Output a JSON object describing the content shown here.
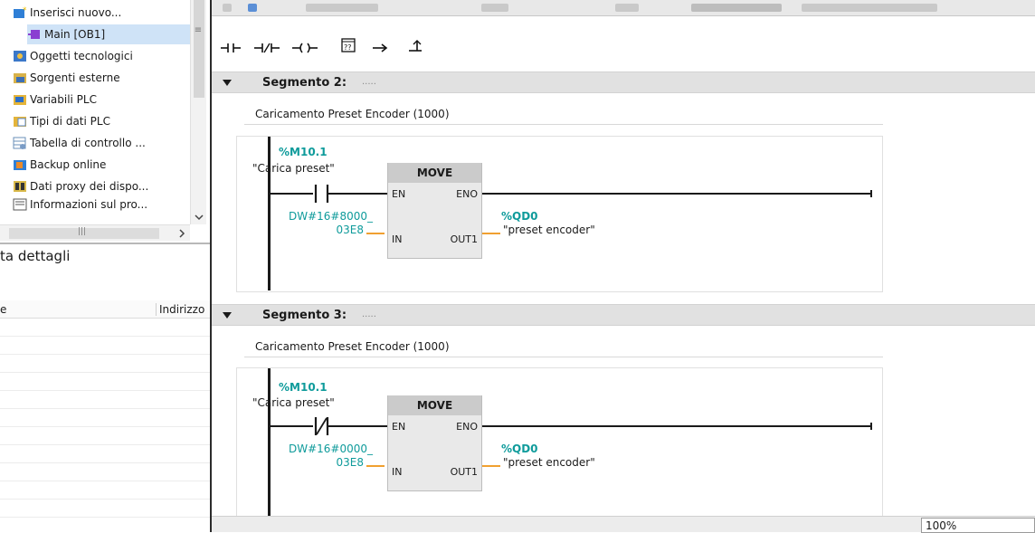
{
  "tree": {
    "items": [
      {
        "label": "Inserisci nuovo...",
        "icon": "add-block-icon",
        "indent": 1
      },
      {
        "label": "Main [OB1]",
        "icon": "ob-block-icon",
        "indent": 2,
        "selected": true
      },
      {
        "label": "Oggetti tecnologici",
        "icon": "technology-objects-icon",
        "indent": 0
      },
      {
        "label": "Sorgenti esterne",
        "icon": "external-sources-icon",
        "indent": 0
      },
      {
        "label": "Variabili PLC",
        "icon": "plc-tags-icon",
        "indent": 0
      },
      {
        "label": "Tipi di dati PLC",
        "icon": "plc-data-types-icon",
        "indent": 0
      },
      {
        "label": "Tabella di controllo ...",
        "icon": "watch-table-icon",
        "indent": 0
      },
      {
        "label": "Backup online",
        "icon": "online-backup-icon",
        "indent": 0
      },
      {
        "label": "Dati proxy dei dispo...",
        "icon": "device-proxy-icon",
        "indent": 0
      },
      {
        "label": "Informazioni sul pro...",
        "icon": "program-info-icon",
        "indent": 0
      }
    ]
  },
  "details": {
    "title": "ta dettagli",
    "col_name": "e",
    "col_address": "Indirizzo"
  },
  "toolbar": {
    "tools": [
      "no-contact-icon",
      "nc-contact-icon",
      "coil-icon",
      "empty-box-icon",
      "open-branch-icon",
      "close-branch-icon"
    ]
  },
  "segments": [
    {
      "title": "Segmento 2:",
      "dots": ".....",
      "comment": "Caricamento Preset Encoder (1000)",
      "contact_type": "normally-open",
      "contact_address": "%M10.1",
      "contact_name": "\"Carica preset\"",
      "box_title": "MOVE",
      "pin_en": "EN",
      "pin_eno": "ENO",
      "pin_in": "IN",
      "pin_out": "OUT1",
      "in_const_line1": "DW#16#8000_",
      "in_const_line2": "03E8",
      "out_address": "%QD0",
      "out_name": "\"preset encoder\""
    },
    {
      "title": "Segmento 3:",
      "dots": ".....",
      "comment": "Caricamento Preset Encoder (1000)",
      "contact_type": "normally-closed",
      "contact_address": "%M10.1",
      "contact_name": "\"Carica preset\"",
      "box_title": "MOVE",
      "pin_en": "EN",
      "pin_eno": "ENO",
      "pin_in": "IN",
      "pin_out": "OUT1",
      "in_const_line1": "DW#16#0000_",
      "in_const_line2": "03E8",
      "out_address": "%QD0",
      "out_name": "\"preset encoder\""
    }
  ],
  "status": {
    "zoom": "100%"
  },
  "colors": {
    "operand_address": "#0f9b9b",
    "segment_bar": "#e1e1e1",
    "box_fill": "#e9e9e9",
    "out_wire": "#f0a030",
    "selection": "#cfe3f7"
  }
}
